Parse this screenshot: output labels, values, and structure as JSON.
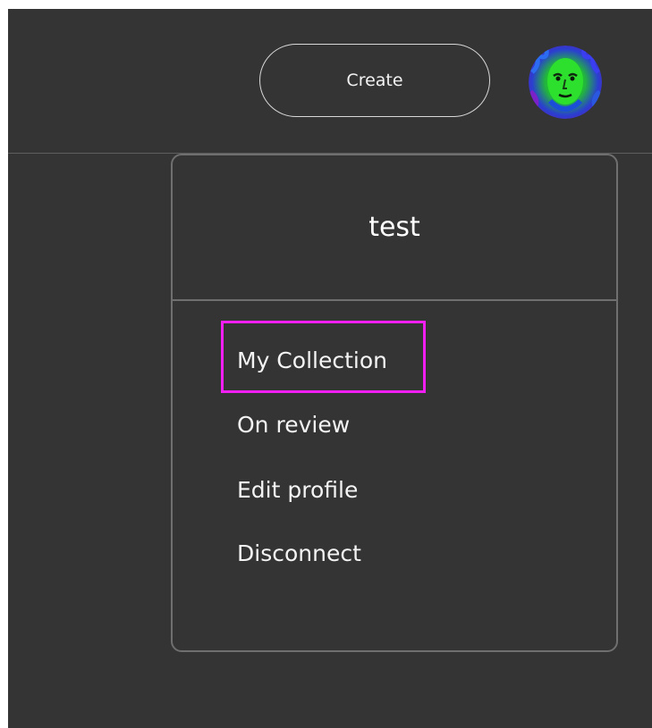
{
  "header": {
    "create_label": "Create",
    "avatar_icon": "avatar-portrait-icon"
  },
  "dropdown": {
    "username": "test",
    "items": [
      {
        "label": "My Collection",
        "highlighted": true
      },
      {
        "label": "On review"
      },
      {
        "label": "Edit profile"
      },
      {
        "label": "Disconnect"
      }
    ]
  },
  "colors": {
    "background": "#343434",
    "text": "#f4f4f4",
    "border": "#6f6f6f",
    "highlight": "#f21ff2"
  }
}
